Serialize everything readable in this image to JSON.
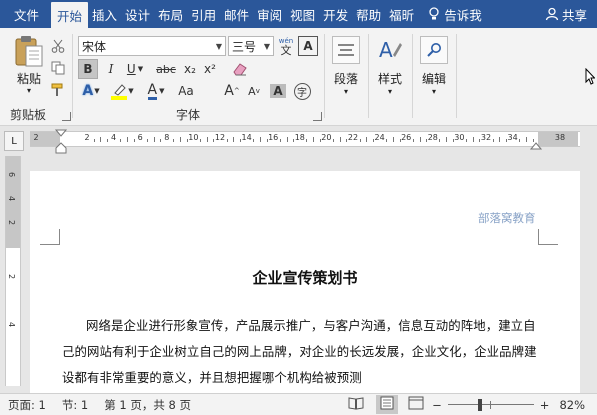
{
  "tabs": [
    {
      "label": "文件"
    },
    {
      "label": "开始"
    },
    {
      "label": "插入"
    },
    {
      "label": "设计"
    },
    {
      "label": "布局"
    },
    {
      "label": "引用"
    },
    {
      "label": "邮件"
    },
    {
      "label": "审阅"
    },
    {
      "label": "视图"
    },
    {
      "label": "开发"
    },
    {
      "label": "帮助"
    },
    {
      "label": "福昕"
    }
  ],
  "tell_me": "告诉我",
  "share": "共享",
  "ribbon": {
    "clipboard": {
      "paste": "粘贴",
      "group": "剪贴板"
    },
    "font": {
      "name": "宋体",
      "size": "三号",
      "wen_top": "wén",
      "wen_bottom": "文",
      "group": "字体",
      "bold": "B",
      "italic": "I",
      "underline": "U",
      "strike": "abc",
      "subscript": "x₂",
      "superscript": "x²",
      "aa_big": "A",
      "aa_small": "A",
      "aa_case": "Aa",
      "char_border": "A",
      "char_shade": "A",
      "enclose": "字"
    },
    "paragraph": {
      "label": "段落"
    },
    "styles": {
      "label": "样式"
    },
    "editing": {
      "label": "编辑"
    }
  },
  "ruler": {
    "corner": "L",
    "left_numbers": [
      "2"
    ],
    "numbers": [
      "2",
      "4",
      "6",
      "8",
      "10",
      "12",
      "14",
      "16",
      "18",
      "20",
      "22",
      "24",
      "26",
      "28",
      "30",
      "32",
      "34"
    ],
    "right_number": "38",
    "vertical_numbers": [
      "6",
      "4",
      "2",
      "2",
      "4"
    ]
  },
  "document": {
    "header": "部落窝教育",
    "title": "企业宣传策划书",
    "paragraph": "网络是企业进行形象宣传，产品展示推广，与客户沟通，信息互动的阵地，建立自己的网站有利于企业树立自己的网上品牌，对企业的长远发展，企业文化，企业品牌建设都有非常重要的意义，并且想把握哪个机构给被预测"
  },
  "status": {
    "page": "页面: 1",
    "section": "节: 1",
    "pages": "第 1 页，共 8 页",
    "zoom": "82%",
    "minus": "−",
    "plus": "+"
  },
  "colors": {
    "brand": "#2b579a",
    "highlight": "#ffff00",
    "font_color": "#2e5fa8"
  }
}
